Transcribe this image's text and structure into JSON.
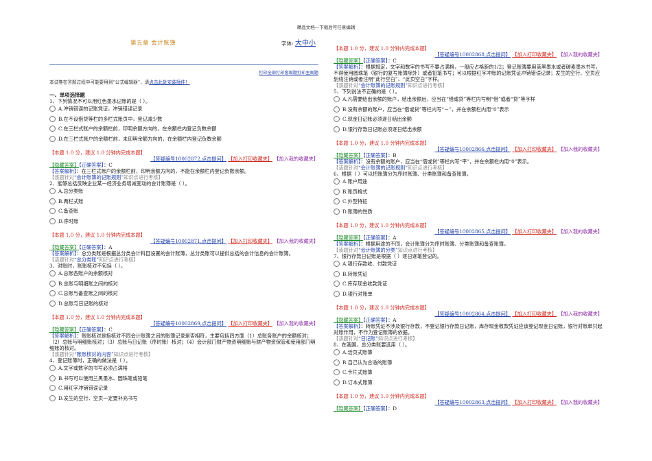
{
  "doc_header": "精品文档---下载后可任意编辑",
  "title": "第五章    会计账簿",
  "font_size_label": "字体:",
  "font_size_link": "大中小",
  "print_links": "打印全部打印客观题打印主观题",
  "notice_prefix": "本试卷在答题过程中可能要用到“公式编辑器”，请",
  "notice_link": "点击此处安装插件！",
  "section_title": "一、单项选择题",
  "left_questions": [
    {
      "text": "1、下列情况不可以用红色墨水记账的是（     ）。",
      "options": [
        "A.冲销错误的记账凭证，冲销错误记录",
        "B.在不设借贷等栏的多栏式账页中，登记减少数",
        "C.在三栏式账户的余额栏前，印明余额方向的，在余额栏内登记负数余额",
        "D.在三栏式账户的余额栏前，未印明余额方向的，在余额栏内登记负数余额"
      ],
      "score": "【本题 1.0 分，建议 1.0 分钟内完成本题】",
      "id_link": "【答疑编号10002872,点击提问】",
      "print_fav": "【加入打印收藏夹】",
      "my_fav": "【加入我的收藏夹】",
      "hide_answer": "【隐藏答案】",
      "correct_label": "【正确答案】",
      "answer": "：C",
      "explain_label": "【答案解析】",
      "explain": "：在三栏式账户的余额栏前，印明余额方向的，不能在余额栏内登记负数余额。",
      "test_prefix": "【该题针对",
      "test_topic": "“会计账簿的记账规则”",
      "test_suffix": "知识点进行考核】"
    },
    {
      "text": "2、能够总括反映企业某一经济业务增减变动的会计账簿是（     ）。",
      "options": [
        "A.总分类账",
        "B.两栏式账",
        "C.备查账",
        "D.序时账"
      ],
      "score": "【本题 1.0 分，建议 1.0 分钟内完成本题】",
      "id_link": "【答疑编号10002871,点击提问】",
      "print_fav": "【加入打印收藏夹】",
      "my_fav": "【加入我的收藏夹】",
      "hide_answer": "【隐藏答案】",
      "correct_label": "【正确答案】",
      "answer": "：A",
      "explain_label": "【答案解析】",
      "explain": "：总分类账是根据总分类会计科目设置的会计账簿，总分类账可以提供总括的会计信息的会计账簿。",
      "test_prefix": "【该题针对",
      "test_topic": "“总分类账”",
      "test_suffix": "知识点进行考核】"
    },
    {
      "text": "3、对账时，账账核对不包括（     ）。",
      "options": [
        "A.总账各账户的余额核对",
        "B.总账与明细账之间的核对",
        "C.总账与备查账之间的核对",
        "D.总账与日记账的核对"
      ],
      "score": "【本题 1.0 分，建议 1.0 分钟内完成本题】",
      "id_link": "【答疑编号10002869,点击提问】",
      "print_fav": "【加入打印收藏夹】",
      "my_fav": "【加入我的收藏夹】",
      "hide_answer": "【隐藏答案】",
      "correct_label": "【正确答案】",
      "answer": "：C",
      "explain_label": "【答案解析】",
      "explain": "：账账核对是指核对不同会计账簿之间的账簿记录是否相符，主要包括四方面（1）总账各账户的余额核对；（2）总账与明细账核对；（3）总账与日记账（序时账）核对；（4）会计部门财产物资明细账与财产物资保管和使用部门明细账的核对。",
      "test_prefix": "【该题针对",
      "test_topic": "“账账核对的内容”",
      "test_suffix": "知识点进行考核】"
    },
    {
      "text": "4、登记账簿时，正确的做法是（     ）。",
      "options": [
        "A.文字或数字的书写必须占满格",
        "B.书写可以使用兰黑墨水、圆珠笔或铅笔",
        "C.用红字冲销错误记录",
        "D.发生的空行、空页一定要补充书写"
      ]
    }
  ],
  "right_top": {
    "score": "【本题 1.0 分，建议 1.0 分钟内完成本题】",
    "id_link": "【答疑编号10002868,点击提问】",
    "print_fav": "【加入打印收藏夹】",
    "my_fav": "【加入我的收藏夹】",
    "hide_answer": "【隐藏答案】",
    "correct_label": "【正确答案】",
    "answer": "：C",
    "explain_label": "【答案解析】",
    "explain": "：根据规定，文字和数字的书写不要占满格，一般应占格距的1/2；登记账簿要用蓝黑墨水或者碳素墨水书写，不得使用圆珠笔（银行的复写账簿除外）或者铅笔书写；可以根据红字冲账的记账凭证冲销错误记录；发生的空行、空页应划线注销或者注明“此行空白”、“此页空白”字样。",
    "test_prefix": "【该题针对",
    "test_topic": "“会计账簿的记账规则”",
    "test_suffix": "知识点进行考核】"
  },
  "right_questions": [
    {
      "text": "5、下列说法不正确的是（     ）。",
      "options": [
        "A.凡需要结出余额的账户，结出余额后，应当在“借或贷”等栏内写明“借”或者“贷”等字样",
        "B.没有余额的账户，应当在“借或贷”等栏内写“－”，并在余额栏内用“0”表示",
        "C.现金日记账必须逐日结出余额",
        "D.银行存款日记账必须逐日结出余额"
      ],
      "score": "【本题 1.0 分，建议 1.0 分钟内完成本题】",
      "id_link": "【答疑编号10002866,点击提问】",
      "print_fav": "【加入打印收藏夹】",
      "my_fav": "【加入我的收藏夹】",
      "hide_answer": "【隐藏答案】",
      "correct_label": "【正确答案】",
      "answer": "：B",
      "explain_label": "【答案解析】",
      "explain": "：没有余额的账户，应当在“借或贷”等栏内写“平”，并在余额栏内用“0”表示。",
      "test_prefix": "【该题针对",
      "test_topic": "“会计账簿的记账规则”",
      "test_suffix": "知识点进行考核】"
    },
    {
      "text": "6、根据（     ）可以把账簿分为序时账簿、分类账簿和备查账簿。",
      "options": [
        "A.账户用途",
        "B.账页格式",
        "C.外型特征",
        "D.账簿的性质"
      ],
      "score": "【本题 1.0 分，建议 1.0 分钟内完成本题】",
      "id_link": "【答疑编号10002865,点击提问】",
      "print_fav": "【加入打印收藏夹】",
      "my_fav": "【加入我的收藏夹】",
      "hide_answer": "【隐藏答案】",
      "correct_label": "【正确答案】",
      "answer": "：A",
      "explain_label": "【答案解析】",
      "explain": "：根据用途的不同，会计账簿分为序时账簿、分类账簿和备查账簿。",
      "test_prefix": "【该题针对",
      "test_topic": "“会计账簿的分类”",
      "test_suffix": "知识点进行考核】"
    },
    {
      "text": "7、银行存款日记账是根据（     ）逐日逐笔登记的。",
      "options": [
        "A.银行存款收、付款凭证",
        "B.转账凭证",
        "C.库存现金收款凭证",
        "D.银行对账单"
      ],
      "score": "【本题 1.0 分，建议 1.0 分钟内完成本题】",
      "id_link": "【答疑编号10002864,点击提问】",
      "print_fav": "【加入打印收藏夹】",
      "my_fav": "【加入我的收藏夹】",
      "hide_answer": "【隐藏答案】",
      "correct_label": "【正确答案】",
      "answer": "：A",
      "explain_label": "【答案解析】",
      "explain": "：转账凭证不涉及银行存款，不登记银行存款日记账，库存现金收款凭证应该登记现金日记账，银行对账单只起对账作用，不作为登记账簿的依据。",
      "test_prefix": "【该题针对",
      "test_topic": "“日记账”",
      "test_suffix": "知识点进行考核】"
    },
    {
      "text": "8、在我国，总分类账要选用（     ）。",
      "options": [
        "A.活页式账簿",
        "B.自己认为合适的账簿",
        "C.卡片式账簿",
        "D.订本式账簿"
      ],
      "score": "【本题 1.0 分，建议 1.0 分钟内完成本题】",
      "id_link": "【答疑编号10002863,点击提问】",
      "print_fav": "【加入打印收藏夹】",
      "my_fav": "【加入我的收藏夹】",
      "hide_answer": "【隐藏答案】",
      "correct_label": "【正确答案】",
      "answer": "：D"
    }
  ]
}
